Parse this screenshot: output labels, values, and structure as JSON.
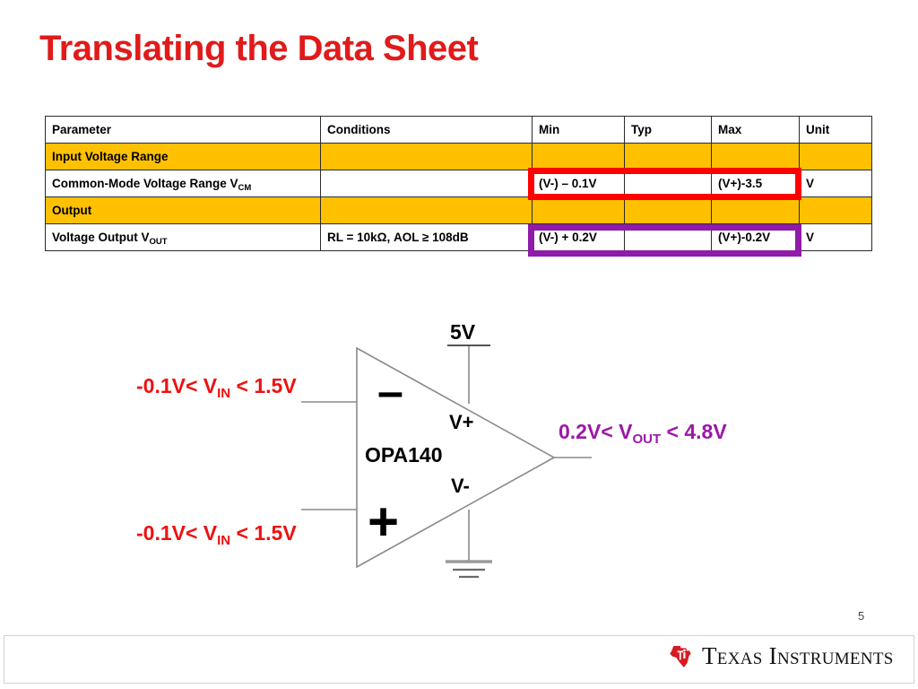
{
  "slide": {
    "title": "Translating the Data Sheet",
    "page_number": "5",
    "title_color": "#E01B1B",
    "section_row_color": "#FFC000",
    "vcm_highlight_color": "#FF0000",
    "vout_highlight_color": "#8F1BA8"
  },
  "table": {
    "headers": {
      "parameter": "Parameter",
      "conditions": "Conditions",
      "min": "Min",
      "typ": "Typ",
      "max": "Max",
      "unit": "Unit"
    },
    "rows": [
      {
        "type": "section",
        "parameter": "Input Voltage Range",
        "conditions": "",
        "min": "",
        "typ": "",
        "max": "",
        "unit": ""
      },
      {
        "type": "data",
        "parameter": "Common-Mode Voltage Range V",
        "parameter_sub": "CM",
        "conditions": "",
        "min": "(V-) – 0.1V",
        "typ": "",
        "max": "(V+)-3.5",
        "unit": "V"
      },
      {
        "type": "section",
        "parameter": "Output",
        "conditions": "",
        "min": "",
        "typ": "",
        "max": "",
        "unit": ""
      },
      {
        "type": "data",
        "parameter": "Voltage Output V",
        "parameter_sub": "OUT",
        "conditions": "RL = 10kΩ, AOL ≥  108dB",
        "min": "(V-) + 0.2V",
        "typ": "",
        "max": "(V+)-0.2V",
        "unit": "V"
      }
    ]
  },
  "diagram": {
    "device_name": "OPA140",
    "supply_label": "5V",
    "vplus_pin": "V+",
    "vminus_pin": "V-",
    "inverting_sign": "–",
    "noninverting_sign": "+",
    "annotation_input_top": "-0.1V< V",
    "annotation_input_top_sub": "IN",
    "annotation_input_top_tail": " < 1.5V",
    "annotation_input_bottom": "-0.1V< V",
    "annotation_input_bottom_sub": "IN",
    "annotation_input_bottom_tail": " < 1.5V",
    "annotation_output": "0.2V< V",
    "annotation_output_sub": "OUT",
    "annotation_output_tail": " < 4.8V"
  },
  "footer": {
    "brand": "Texas Instruments",
    "logo_color": "#D81B23"
  }
}
